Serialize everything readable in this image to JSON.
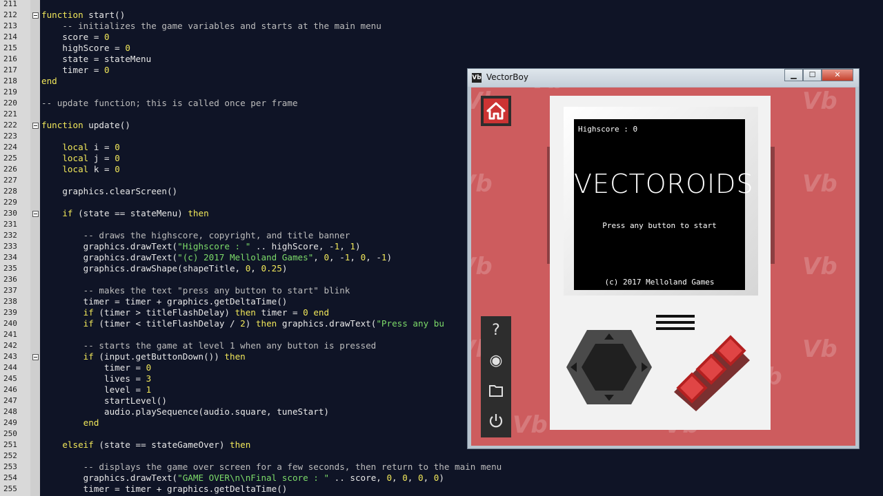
{
  "editor": {
    "lines": [
      {
        "n": "211",
        "fold": false,
        "html": ""
      },
      {
        "n": "212",
        "fold": true,
        "html": "<span class='kw'>function</span> start()"
      },
      {
        "n": "213",
        "fold": false,
        "html": "    <span class='cm'>-- initializes the game variables and starts at the main menu</span>"
      },
      {
        "n": "214",
        "fold": false,
        "html": "    score = <span class='num'>0</span>"
      },
      {
        "n": "215",
        "fold": false,
        "html": "    highScore = <span class='num'>0</span>"
      },
      {
        "n": "216",
        "fold": false,
        "html": "    state = stateMenu"
      },
      {
        "n": "217",
        "fold": false,
        "html": "    timer = <span class='num'>0</span>"
      },
      {
        "n": "218",
        "fold": false,
        "html": "<span class='kw'>end</span>"
      },
      {
        "n": "219",
        "fold": false,
        "html": ""
      },
      {
        "n": "220",
        "fold": false,
        "html": "<span class='cm'>-- update function; this is called once per frame</span>"
      },
      {
        "n": "221",
        "fold": false,
        "html": ""
      },
      {
        "n": "222",
        "fold": true,
        "html": "<span class='kw'>function</span> update()"
      },
      {
        "n": "223",
        "fold": false,
        "html": ""
      },
      {
        "n": "224",
        "fold": false,
        "html": "    <span class='kw'>local</span> i = <span class='num'>0</span>"
      },
      {
        "n": "225",
        "fold": false,
        "html": "    <span class='kw'>local</span> j = <span class='num'>0</span>"
      },
      {
        "n": "226",
        "fold": false,
        "html": "    <span class='kw'>local</span> k = <span class='num'>0</span>"
      },
      {
        "n": "227",
        "fold": false,
        "html": ""
      },
      {
        "n": "228",
        "fold": false,
        "html": "    graphics.clearScreen()"
      },
      {
        "n": "229",
        "fold": false,
        "html": ""
      },
      {
        "n": "230",
        "fold": true,
        "html": "    <span class='kw'>if</span> (state == stateMenu) <span class='kw'>then</span>"
      },
      {
        "n": "231",
        "fold": false,
        "html": ""
      },
      {
        "n": "232",
        "fold": false,
        "html": "        <span class='cm'>-- draws the highscore, copyright, and title banner</span>"
      },
      {
        "n": "233",
        "fold": false,
        "html": "        graphics.drawText(<span class='str'>\"Highscore : \"</span> .. highScore, -<span class='num'>1</span>, <span class='num'>1</span>)"
      },
      {
        "n": "234",
        "fold": false,
        "html": "        graphics.drawText(<span class='str'>\"(c) 2017 Melloland Games\"</span>, <span class='num'>0</span>, -<span class='num'>1</span>, <span class='num'>0</span>, -<span class='num'>1</span>)"
      },
      {
        "n": "235",
        "fold": false,
        "html": "        graphics.drawShape(shapeTitle, <span class='num'>0</span>, <span class='num'>0.25</span>)"
      },
      {
        "n": "236",
        "fold": false,
        "html": ""
      },
      {
        "n": "237",
        "fold": false,
        "html": "        <span class='cm'>-- makes the text \"press any button to start\" blink</span>"
      },
      {
        "n": "238",
        "fold": false,
        "html": "        timer = timer + graphics.getDeltaTime()"
      },
      {
        "n": "239",
        "fold": false,
        "html": "        <span class='kw'>if</span> (timer > titleFlashDelay) <span class='kw'>then</span> timer = <span class='num'>0</span> <span class='kw'>end</span>"
      },
      {
        "n": "240",
        "fold": false,
        "html": "        <span class='kw'>if</span> (timer < titleFlashDelay / <span class='num'>2</span>) <span class='kw'>then</span> graphics.drawText(<span class='str'>\"Press any bu</span>"
      },
      {
        "n": "241",
        "fold": false,
        "html": ""
      },
      {
        "n": "242",
        "fold": false,
        "html": "        <span class='cm'>-- starts the game at level 1 when any button is pressed</span>"
      },
      {
        "n": "243",
        "fold": true,
        "html": "        <span class='kw'>if</span> (input.getButtonDown()) <span class='kw'>then</span>"
      },
      {
        "n": "244",
        "fold": false,
        "html": "            timer = <span class='num'>0</span>"
      },
      {
        "n": "245",
        "fold": false,
        "html": "            lives = <span class='num'>3</span>"
      },
      {
        "n": "246",
        "fold": false,
        "html": "            level = <span class='num'>1</span>"
      },
      {
        "n": "247",
        "fold": false,
        "html": "            startLevel()"
      },
      {
        "n": "248",
        "fold": false,
        "html": "            audio.playSequence(audio.square, tuneStart)"
      },
      {
        "n": "249",
        "fold": false,
        "html": "        <span class='kw'>end</span>"
      },
      {
        "n": "250",
        "fold": false,
        "html": ""
      },
      {
        "n": "251",
        "fold": false,
        "html": "    <span class='kw'>elseif</span> (state == stateGameOver) <span class='kw'>then</span>"
      },
      {
        "n": "252",
        "fold": false,
        "html": ""
      },
      {
        "n": "253",
        "fold": false,
        "html": "        <span class='cm'>-- displays the game over screen for a few seconds, then return to the main menu</span>"
      },
      {
        "n": "254",
        "fold": false,
        "html": "        graphics.drawText(<span class='str'>\"GAME OVER\\n\\nFinal score : \"</span> .. score, <span class='num'>0</span>, <span class='num'>0</span>, <span class='num'>0</span>, <span class='num'>0</span>)"
      },
      {
        "n": "255",
        "fold": false,
        "html": "        timer = timer + graphics.getDeltaTime()"
      }
    ]
  },
  "window": {
    "icon_label": "Vb",
    "title": "VectorBoy",
    "minimize": "▁",
    "maximize": "☐",
    "close": "✕",
    "watermark": "Vb"
  },
  "sidebar": {
    "home_icon": "home-icon",
    "items": [
      {
        "name": "help-icon",
        "glyph": "?"
      },
      {
        "name": "record-icon",
        "glyph": "◉"
      },
      {
        "name": "folder-icon",
        "glyph": "▭"
      },
      {
        "name": "power-icon",
        "glyph": "⏻"
      }
    ]
  },
  "game_screen": {
    "highscore": "Highscore : 0",
    "title": "VECTOROIDS",
    "prompt": "Press any button to start",
    "copyright": "(c) 2017 Melloland Games"
  },
  "colors": {
    "background_red": "#cd5c5e",
    "button_red": "#cc3333",
    "editor_bg": "#0f1426"
  }
}
